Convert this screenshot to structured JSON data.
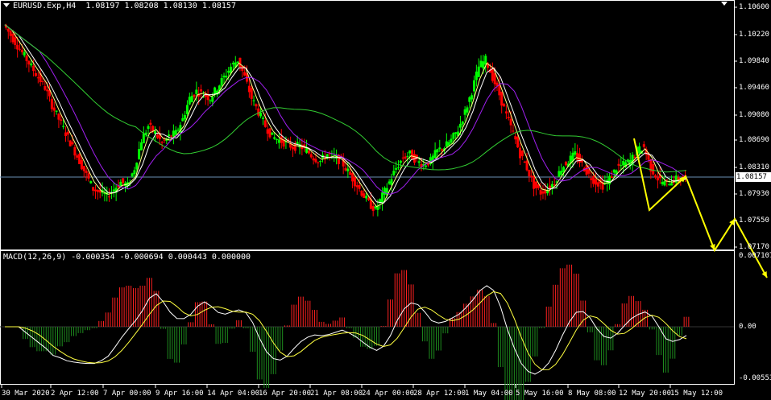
{
  "header": {
    "symbol": "EURUSD.Exp,H4",
    "ohlc": "1.08197 1.08208 1.08130 1.08157"
  },
  "macd": {
    "title": "MACD(12,26,9) -0.000354 -0.000694 0.000443 0.000000"
  },
  "price_axis": {
    "labels": [
      "1.10600",
      "1.10220",
      "1.09840",
      "1.09460",
      "1.09080",
      "1.08690",
      "1.08310",
      "1.07930",
      "1.07550",
      "1.07170"
    ],
    "current_price": "1.08157"
  },
  "macd_axis": {
    "labels": [
      "0.007107",
      "0.00",
      "-0.005539"
    ]
  },
  "time_axis": {
    "labels": [
      "30 Mar 2020",
      "2 Apr 12:00",
      "7 Apr 00:00",
      "9 Apr 16:00",
      "14 Apr 04:00",
      "16 Apr 20:00",
      "21 Apr 08:00",
      "24 Apr 00:00",
      "28 Apr 12:00",
      "1 May 04:00",
      "5 May 16:00",
      "8 May 08:00",
      "12 May 20:00",
      "15 May 12:00"
    ]
  },
  "colors": {
    "background": "#000000",
    "bull_candle": "#00ff00",
    "bear_candle": "#ff0000",
    "ma_fast": "#ffff80",
    "ma_mid": "#ffffff",
    "ma_slow": "#a020f0",
    "ma_long": "#32cd32",
    "macd_hist_pos": "#ff2020",
    "macd_hist_neg": "#1e8c1e",
    "macd_signal": "#ffff40",
    "projection": "#ffff00",
    "price_line": "#6a8fb5"
  },
  "chart_data": {
    "type": "candlestick",
    "timeframe": "H4",
    "close": [
      1.1035,
      1.102,
      1.1005,
      1.099,
      1.0975,
      1.096,
      1.0945,
      1.092,
      1.09,
      1.088,
      1.086,
      1.084,
      1.082,
      1.08,
      1.0795,
      1.079,
      1.08,
      1.081,
      1.0805,
      1.083,
      1.087,
      1.089,
      1.088,
      1.0865,
      1.0875,
      1.088,
      1.09,
      1.093,
      1.094,
      1.0935,
      1.093,
      1.0945,
      1.096,
      1.0975,
      1.0985,
      1.096,
      1.093,
      1.091,
      1.089,
      1.0875,
      1.087,
      1.0865,
      1.086,
      1.0862,
      1.0855,
      1.0845,
      1.084,
      1.085,
      1.0845,
      1.084,
      1.0825,
      1.081,
      1.0795,
      1.078,
      1.077,
      1.079,
      1.081,
      1.083,
      1.0845,
      1.085,
      1.084,
      1.0835,
      1.084,
      1.0855,
      1.086,
      1.087,
      1.0885,
      1.091,
      1.094,
      1.0975,
      1.0985,
      1.096,
      1.0935,
      1.0905,
      1.088,
      1.085,
      1.083,
      1.0805,
      1.0795,
      1.08,
      1.081,
      1.083,
      1.084,
      1.085,
      1.0835,
      1.082,
      1.081,
      1.0805,
      1.0815,
      1.083,
      1.0835,
      1.084,
      1.0855,
      1.086,
      1.083,
      1.0815,
      1.0808,
      1.0812,
      1.0815,
      1.0816
    ],
    "moving_averages": 4,
    "projection_path": [
      1.08157,
      1.0719,
      1.0755,
      1.069
    ],
    "macd_params": "12,26,9"
  }
}
